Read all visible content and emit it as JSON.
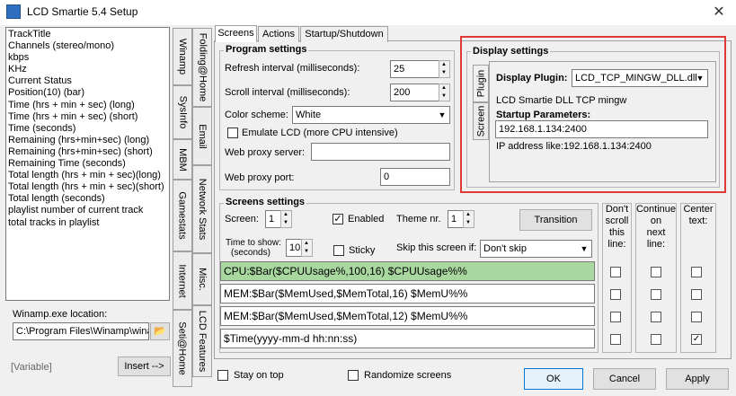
{
  "window": {
    "title": "LCD Smartie 5.4 Setup",
    "close_glyph": "✕"
  },
  "left_list": {
    "items": [
      "TrackTitle",
      "Channels (stereo/mono)",
      "kbps",
      "KHz",
      "Current Status",
      "Position(10) (bar)",
      "Time (hrs + min + sec) (long)",
      "Time (hrs + min + sec) (short)",
      "Time (seconds)",
      "Remaining (hrs+min+sec) (long)",
      "Remaining (hrs+min+sec) (short)",
      "Remaining Time (seconds)",
      "Total length (hrs + min + sec)(long)",
      "Total length (hrs + min + sec)(short)",
      "Total length (seconds)",
      "playlist number of current track",
      "total tracks in playlist"
    ]
  },
  "winamp": {
    "location_label": "Winamp.exe location:",
    "location_value": "C:\\Program Files\\Winamp\\winamp.exe",
    "variable_label": "[Variable]",
    "insert_button": "Insert -->"
  },
  "vtabs_col1": [
    "Winamp",
    "SysInfo",
    "MBM",
    "Gamestats",
    "Internet"
  ],
  "vtabs_col2": [
    "Folding@Home",
    "Email",
    "Network Stats",
    "Misc.",
    "LCD Features",
    "Seti@Home"
  ],
  "tabs": [
    "Screens",
    "Actions",
    "Startup/Shutdown"
  ],
  "program_settings": {
    "title": "Program settings",
    "refresh_label": "Refresh interval (milliseconds):",
    "refresh_value": "25",
    "scroll_label": "Scroll interval (milliseconds):",
    "scroll_value": "200",
    "color_label": "Color scheme:",
    "color_value": "White",
    "emulate_label": "Emulate LCD  (more CPU intensive)",
    "proxy_server_label": "Web proxy server:",
    "proxy_server_value": "",
    "proxy_port_label": "Web proxy port:",
    "proxy_port_value": "0"
  },
  "display_settings": {
    "title": "Display settings",
    "plugin_tab": "Plugin",
    "screen_tab": "Screen",
    "plugin_label": "Display Plugin:",
    "plugin_value": "LCD_TCP_MINGW_DLL.dll",
    "plugin_desc": "LCD Smartie DLL TCP mingw",
    "startup_label": "Startup Parameters:",
    "startup_value": "192.168.1.134:2400",
    "ip_hint": "IP address like:192.168.1.134:2400"
  },
  "screens_settings": {
    "title": "Screens settings",
    "screen_label": "Screen:",
    "screen_value": "1",
    "enabled_label": "Enabled",
    "theme_label": "Theme nr.",
    "theme_value": "1",
    "transition_button": "Transition",
    "time_show_label_1": "Time to show:",
    "time_show_label_2": "(seconds)",
    "time_show_value": "10",
    "sticky_label": "Sticky",
    "skip_label": "Skip this screen if:",
    "skip_value": "Don't skip",
    "col_dont_scroll": [
      "Don't",
      "scroll",
      "this",
      "line:"
    ],
    "col_continue": [
      "Continue",
      "on",
      "next",
      "line:"
    ],
    "col_center": [
      "Center",
      "text:"
    ],
    "lines": [
      {
        "text": "CPU:$Bar($CPUUsage%,100,16) $CPUUsage%%",
        "center": false
      },
      {
        "text": "MEM:$Bar($MemUsed,$MemTotal,16) $MemU%%",
        "center": false
      },
      {
        "text": "MEM:$Bar($MemUsed,$MemTotal,12) $MemU%%",
        "center": false
      },
      {
        "text": "$Time(yyyy-mm-d hh:nn:ss)",
        "center": true
      }
    ]
  },
  "bottom": {
    "stay_on_top": "Stay on top",
    "randomize": "Randomize screens",
    "ok": "OK",
    "cancel": "Cancel",
    "apply": "Apply"
  },
  "glyphs": {
    "check": "✓",
    "arrow_down": "▼",
    "folder": "📂"
  },
  "colors": {
    "active_line": "#a8d8a0",
    "highlight_border": "#e0393a"
  }
}
